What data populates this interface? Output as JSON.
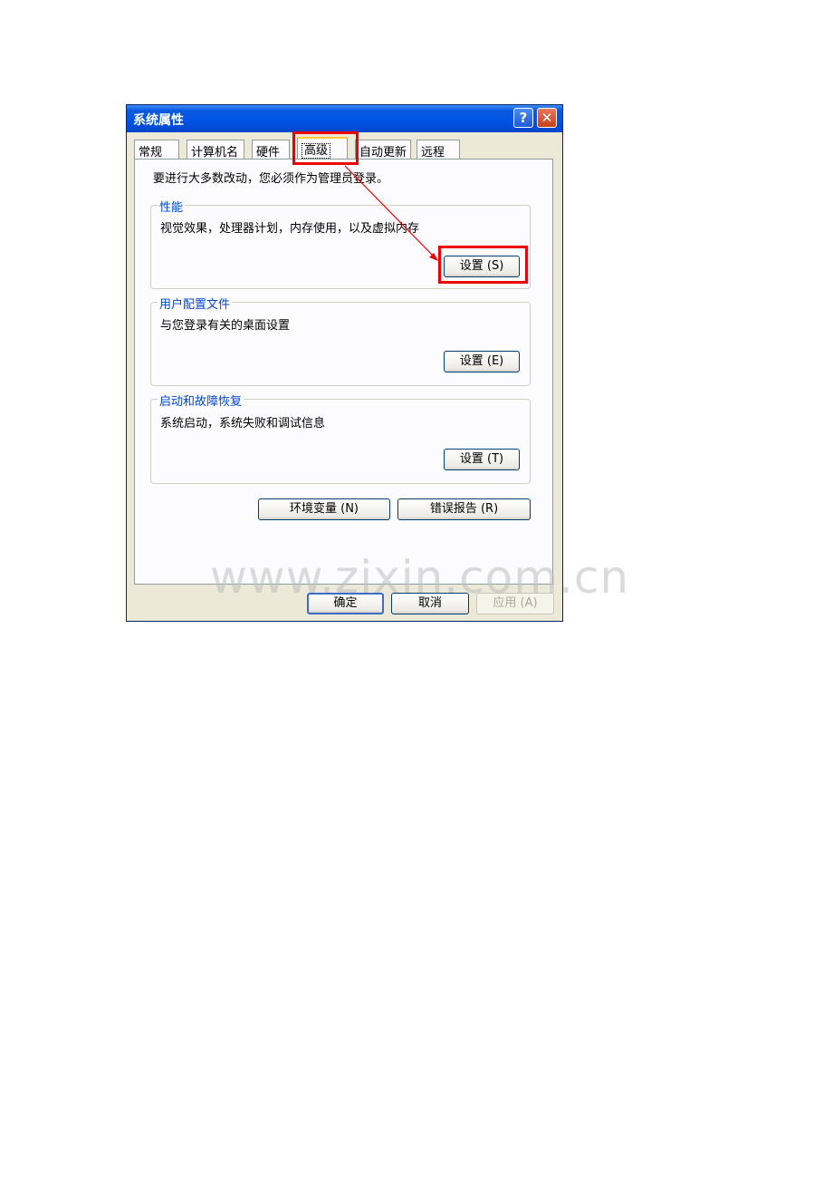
{
  "window": {
    "title": "系统属性",
    "help_glyph": "?",
    "close_glyph": "✕"
  },
  "tabs": [
    {
      "label": "常规"
    },
    {
      "label": "计算机名"
    },
    {
      "label": "硬件"
    },
    {
      "label": "高级",
      "active": true
    },
    {
      "label": "自动更新"
    },
    {
      "label": "远程"
    }
  ],
  "panel": {
    "intro": "要进行大多数改动，您必须作为管理员登录。",
    "groups": [
      {
        "label": "性能",
        "desc": "视觉效果，处理器计划，内存使用，以及虚拟内存",
        "button": "设置 (S)"
      },
      {
        "label": "用户配置文件",
        "desc": "与您登录有关的桌面设置",
        "button": "设置 (E)"
      },
      {
        "label": "启动和故障恢复",
        "desc": "系统启动，系统失败和调试信息",
        "button": "设置 (T)"
      }
    ],
    "env_button": "环境变量 (N)",
    "error_button": "错误报告 (R)"
  },
  "footer": {
    "ok": "确定",
    "cancel": "取消",
    "apply": "应用 (A)"
  },
  "watermark": "www.zixin.com.cn",
  "colors": {
    "titlebar": "#0054e3",
    "highlight": "#ef0000",
    "group_label": "#0046d5"
  }
}
